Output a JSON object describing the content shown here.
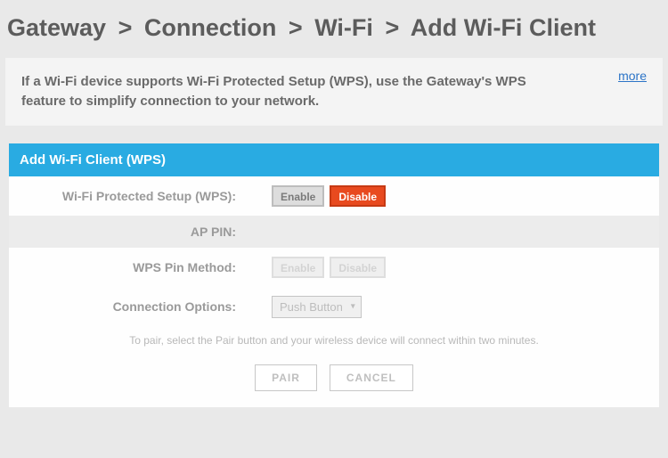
{
  "breadcrumb": {
    "gateway": "Gateway",
    "connection": "Connection",
    "wifi": "Wi-Fi",
    "add_client": "Add Wi-Fi Client"
  },
  "info": {
    "text": "If a Wi-Fi device supports Wi-Fi Protected Setup (WPS), use the Gateway's WPS feature to simplify connection to your network.",
    "more": "more"
  },
  "section": {
    "title": "Add Wi-Fi Client (WPS)"
  },
  "labels": {
    "wps": "Wi-Fi Protected Setup (WPS):",
    "ap_pin": "AP PIN:",
    "wps_pin_method": "WPS Pin Method:",
    "connection_options": "Connection Options:"
  },
  "buttons": {
    "enable": "Enable",
    "disable": "Disable",
    "pair": "PAIR",
    "cancel": "CANCEL"
  },
  "select": {
    "connection_option_value": "Push Button"
  },
  "hint": "To pair, select the Pair button and your wireless device will connect within two minutes."
}
